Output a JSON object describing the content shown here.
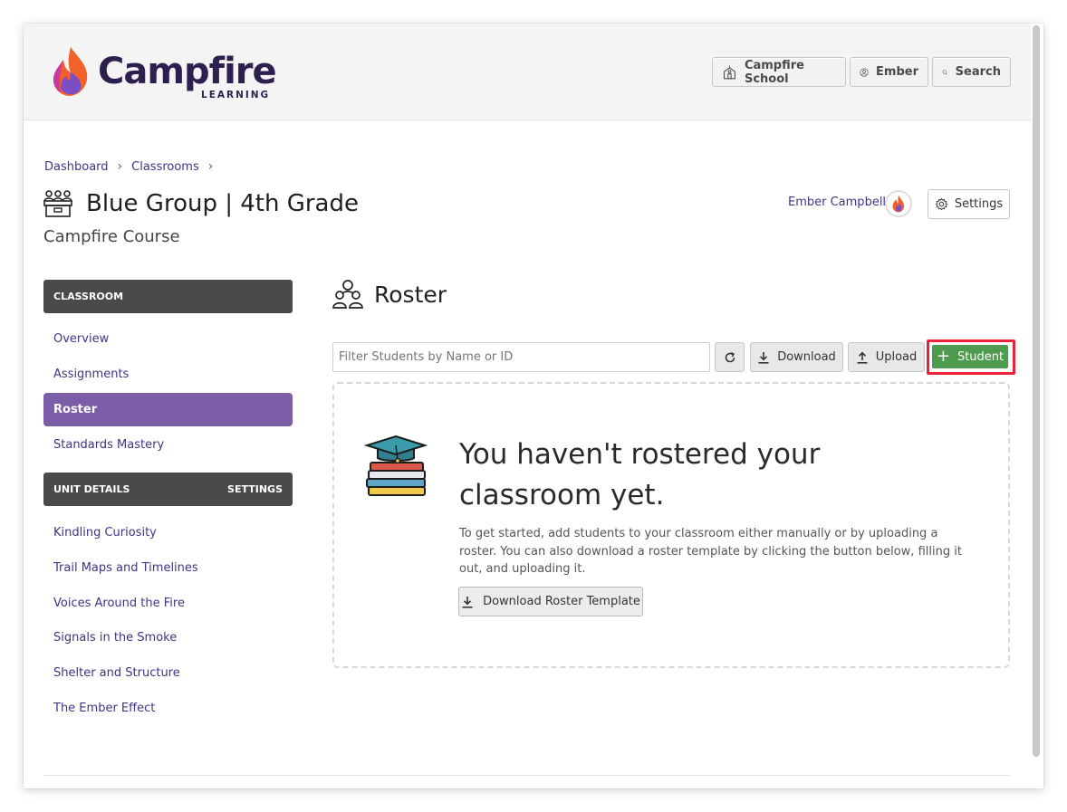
{
  "header": {
    "logo_text": "Campfire",
    "logo_subtext": "LEARNING",
    "school_label": "Campfire School",
    "user_label": "Ember",
    "search_label": "Search"
  },
  "breadcrumb": {
    "items": [
      "Dashboard",
      "Classrooms"
    ]
  },
  "page": {
    "title": "Blue Group | 4th Grade",
    "subtitle": "Campfire Course",
    "teacher_name": "Ember Campbell",
    "settings_label": "Settings"
  },
  "sidebar": {
    "classroom_header": "CLASSROOM",
    "classroom_items": [
      {
        "label": "Overview",
        "active": false
      },
      {
        "label": "Assignments",
        "active": false
      },
      {
        "label": "Roster",
        "active": true
      },
      {
        "label": "Standards Mastery",
        "active": false
      }
    ],
    "unit_header": "UNIT DETAILS",
    "unit_settings": "SETTINGS",
    "unit_items": [
      {
        "label": "Kindling Curiosity"
      },
      {
        "label": "Trail Maps and Timelines"
      },
      {
        "label": "Voices Around the Fire"
      },
      {
        "label": "Signals in the Smoke"
      },
      {
        "label": "Shelter and Structure"
      },
      {
        "label": "The Ember Effect"
      }
    ]
  },
  "roster": {
    "title": "Roster",
    "filter_placeholder": "Filter Students by Name or ID",
    "download_label": "Download",
    "upload_label": "Upload",
    "student_label": "Student",
    "empty_title": "You haven't rostered your classroom yet.",
    "empty_text": "To get started, add students to your classroom either manually or by uploading a roster. You can also download a roster template by clicking the button below, filling it out, and uploading it.",
    "template_label": "Download Roster Template"
  },
  "colors": {
    "brand": "#2d1f4e",
    "link": "#3d3585",
    "active": "#7b5ea7",
    "success": "#4e9a4f",
    "highlight": "#e8233a"
  }
}
